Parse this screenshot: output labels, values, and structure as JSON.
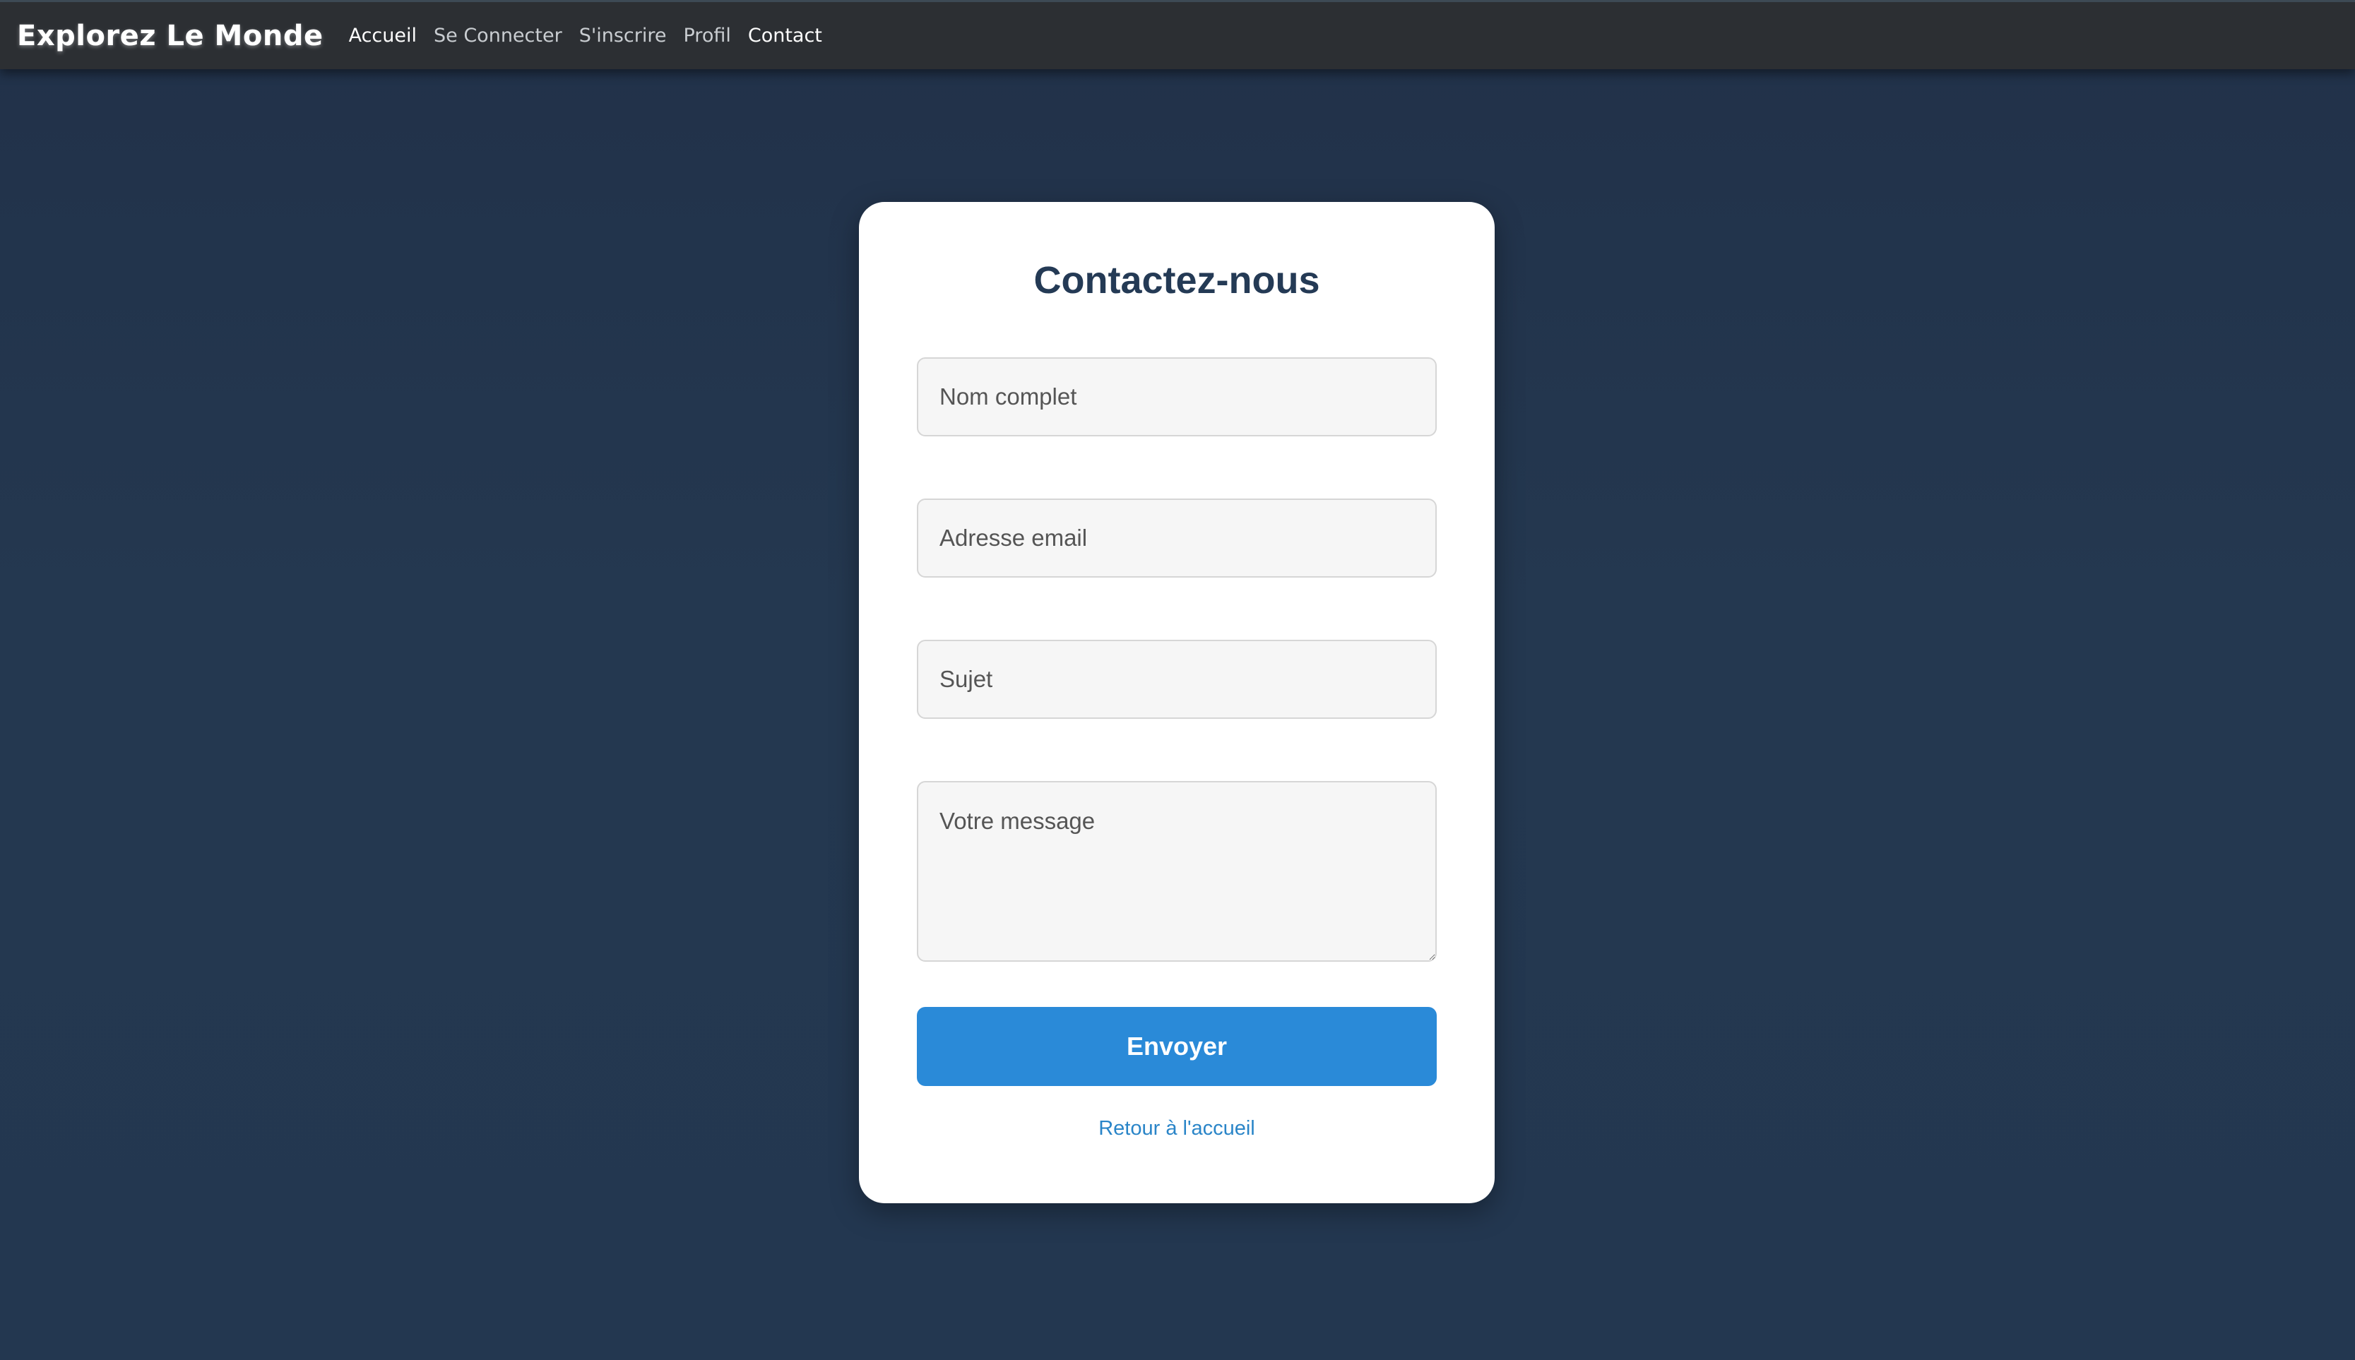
{
  "navbar": {
    "brand": "Explorez Le Monde",
    "links": [
      {
        "label": "Accueil"
      },
      {
        "label": "Se Connecter"
      },
      {
        "label": "S'inscrire"
      },
      {
        "label": "Profil"
      },
      {
        "label": "Contact"
      }
    ]
  },
  "form": {
    "title": "Contactez-nous",
    "name_placeholder": "Nom complet",
    "email_placeholder": "Adresse email",
    "subject_placeholder": "Sujet",
    "message_placeholder": "Votre message",
    "submit_label": "Envoyer",
    "back_link": "Retour à l'accueil"
  },
  "colors": {
    "page_background": "#223550",
    "navbar_background": "#2c2f33",
    "accent_button": "#2a8ad8",
    "title_text": "#243a55",
    "link_text": "#2a85c8"
  }
}
